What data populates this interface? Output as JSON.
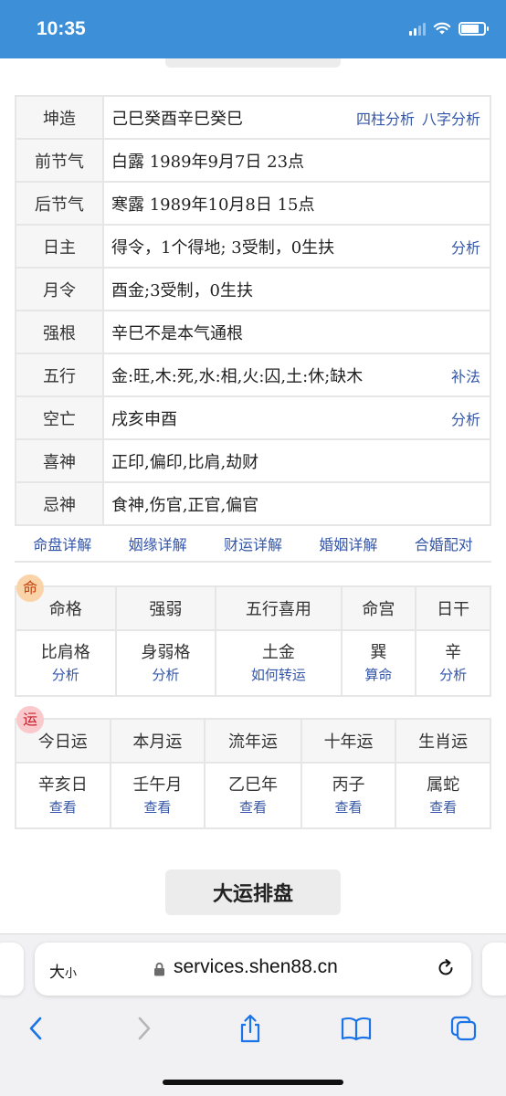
{
  "status_bar": {
    "time": "10:35"
  },
  "info": {
    "rows": [
      {
        "label": "坤造",
        "value": "己巳癸酉辛巳癸巳",
        "links": [
          "四柱分析",
          "八字分析"
        ]
      },
      {
        "label": "前节气",
        "value": "白露 1989年9月7日 23点"
      },
      {
        "label": "后节气",
        "value": "寒露 1989年10月8日 15点"
      },
      {
        "label": "日主",
        "value": "得令，1个得地; 3受制，0生扶",
        "link": "分析"
      },
      {
        "label": "月令",
        "value": "酉金;3受制，0生扶"
      },
      {
        "label": "强根",
        "value": "辛巳不是本气通根"
      },
      {
        "label": "五行",
        "value": "金:旺,木:死,水:相,火:囚,土:休;缺木",
        "link": "补法"
      },
      {
        "label": "空亡",
        "value": "戌亥申酉",
        "link": "分析"
      },
      {
        "label": "喜神",
        "value": "正印,偏印,比肩,劫财"
      },
      {
        "label": "忌神",
        "value": "食神,伤官,正官,偏官"
      }
    ]
  },
  "detail_links": [
    "命盘详解",
    "姻缘详解",
    "财运详解",
    "婚姻详解",
    "合婚配对"
  ],
  "ming": {
    "badge": "命",
    "headers": [
      "命格",
      "强弱",
      "五行喜用",
      "命宫",
      "日干"
    ],
    "cells": [
      {
        "value": "比肩格",
        "link": "分析"
      },
      {
        "value": "身弱格",
        "link": "分析"
      },
      {
        "value": "土金",
        "link": "如何转运"
      },
      {
        "value": "巽",
        "link": "算命"
      },
      {
        "value": "辛",
        "link": "分析"
      }
    ]
  },
  "yun": {
    "badge": "运",
    "headers": [
      "今日运",
      "本月运",
      "流年运",
      "十年运",
      "生肖运"
    ],
    "cells": [
      {
        "value": "辛亥日",
        "link": "查看"
      },
      {
        "value": "壬午月",
        "link": "查看"
      },
      {
        "value": "乙巳年",
        "link": "查看"
      },
      {
        "value": "丙子",
        "link": "查看"
      },
      {
        "value": "属蛇",
        "link": "查看"
      }
    ]
  },
  "dayun_button": "大运排盘",
  "browser": {
    "text_size_big": "大",
    "text_size_small": "小",
    "url": "services.shen88.cn"
  },
  "icons": {
    "lock": "lock-icon",
    "reload": "reload-icon",
    "back": "chevron-left-icon",
    "forward": "chevron-right-icon",
    "share": "share-icon",
    "bookmarks": "book-icon",
    "tabs": "tabs-icon"
  },
  "colors": {
    "status_bar": "#3d8fd8",
    "link": "#3456a8",
    "ming_badge": "#fbd3a8",
    "yun_badge": "#f9c9cc",
    "browser_accent": "#1a73e8"
  }
}
